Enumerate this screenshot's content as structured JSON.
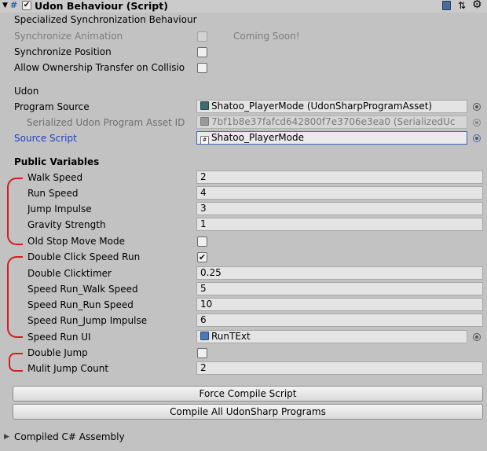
{
  "header": {
    "component_title": "Udon Behaviour (Script)",
    "enabled": true,
    "expand_icon": "foldout-expanded-icon",
    "script_icon": "script-hash-icon",
    "help_icon": "book-help-icon",
    "preset_icon": "preset-sliders-icon",
    "settings_icon": "gear-icon"
  },
  "sync": {
    "section_label": "Specialized Synchronization Behaviour",
    "synchronize_animation": {
      "label": "Synchronize Animation",
      "checked": false,
      "note": "Coming Soon!"
    },
    "synchronize_position": {
      "label": "Synchronize Position",
      "checked": false
    },
    "allow_ownership": {
      "label": "Allow Ownership Transfer on Collisio",
      "checked": false
    }
  },
  "udon": {
    "section_label": "Udon",
    "program_source": {
      "label": "Program Source",
      "value": "Shatoo_PlayerMode (UdonSharpProgramAsset)"
    },
    "serialized_asset": {
      "label": "Serialized Udon Program Asset ID",
      "value": "7bf1b8e37fafcd642800f7e3706e3ea0 (SerializedUc"
    },
    "source_script": {
      "label": "Source Script",
      "value": "Shatoo_PlayerMode"
    }
  },
  "public_variables": {
    "section_label": "Public Variables",
    "walk_speed": {
      "label": "Walk Speed",
      "value": "2"
    },
    "run_speed": {
      "label": "Run Speed",
      "value": "4"
    },
    "jump_impulse": {
      "label": "Jump Impulse",
      "value": "3"
    },
    "gravity_strength": {
      "label": "Gravity Strength",
      "value": "1"
    },
    "old_stop_move_mode": {
      "label": "Old Stop Move Mode",
      "checked": false
    },
    "double_click_speed_run": {
      "label": "Double Click Speed Run",
      "checked": true
    },
    "double_clicktimer": {
      "label": "Double Clicktimer",
      "value": "0.25"
    },
    "speed_run_walk_speed": {
      "label": "Speed Run_Walk Speed",
      "value": "5"
    },
    "speed_run_run_speed": {
      "label": "Speed Run_Run Speed",
      "value": "10"
    },
    "speed_run_jump_impulse": {
      "label": "Speed Run_Jump Impulse",
      "value": "6"
    },
    "speed_run_ui": {
      "label": "Speed Run UI",
      "value": "RunTExt"
    },
    "double_jump": {
      "label": "Double Jump",
      "checked": false
    },
    "mulit_jump_count": {
      "label": "Mulit Jump Count",
      "value": "2"
    }
  },
  "buttons": {
    "force_compile": "Force Compile Script",
    "compile_all": "Compile All UdonSharp Programs"
  },
  "footer": {
    "compiled_assembly": "Compiled C# Assembly"
  },
  "colors": {
    "panel_bg": "#c2c2c2",
    "link_blue": "#1e3cc8",
    "annotation_red": "#d21f1f",
    "selection_border": "#3f63b8"
  }
}
